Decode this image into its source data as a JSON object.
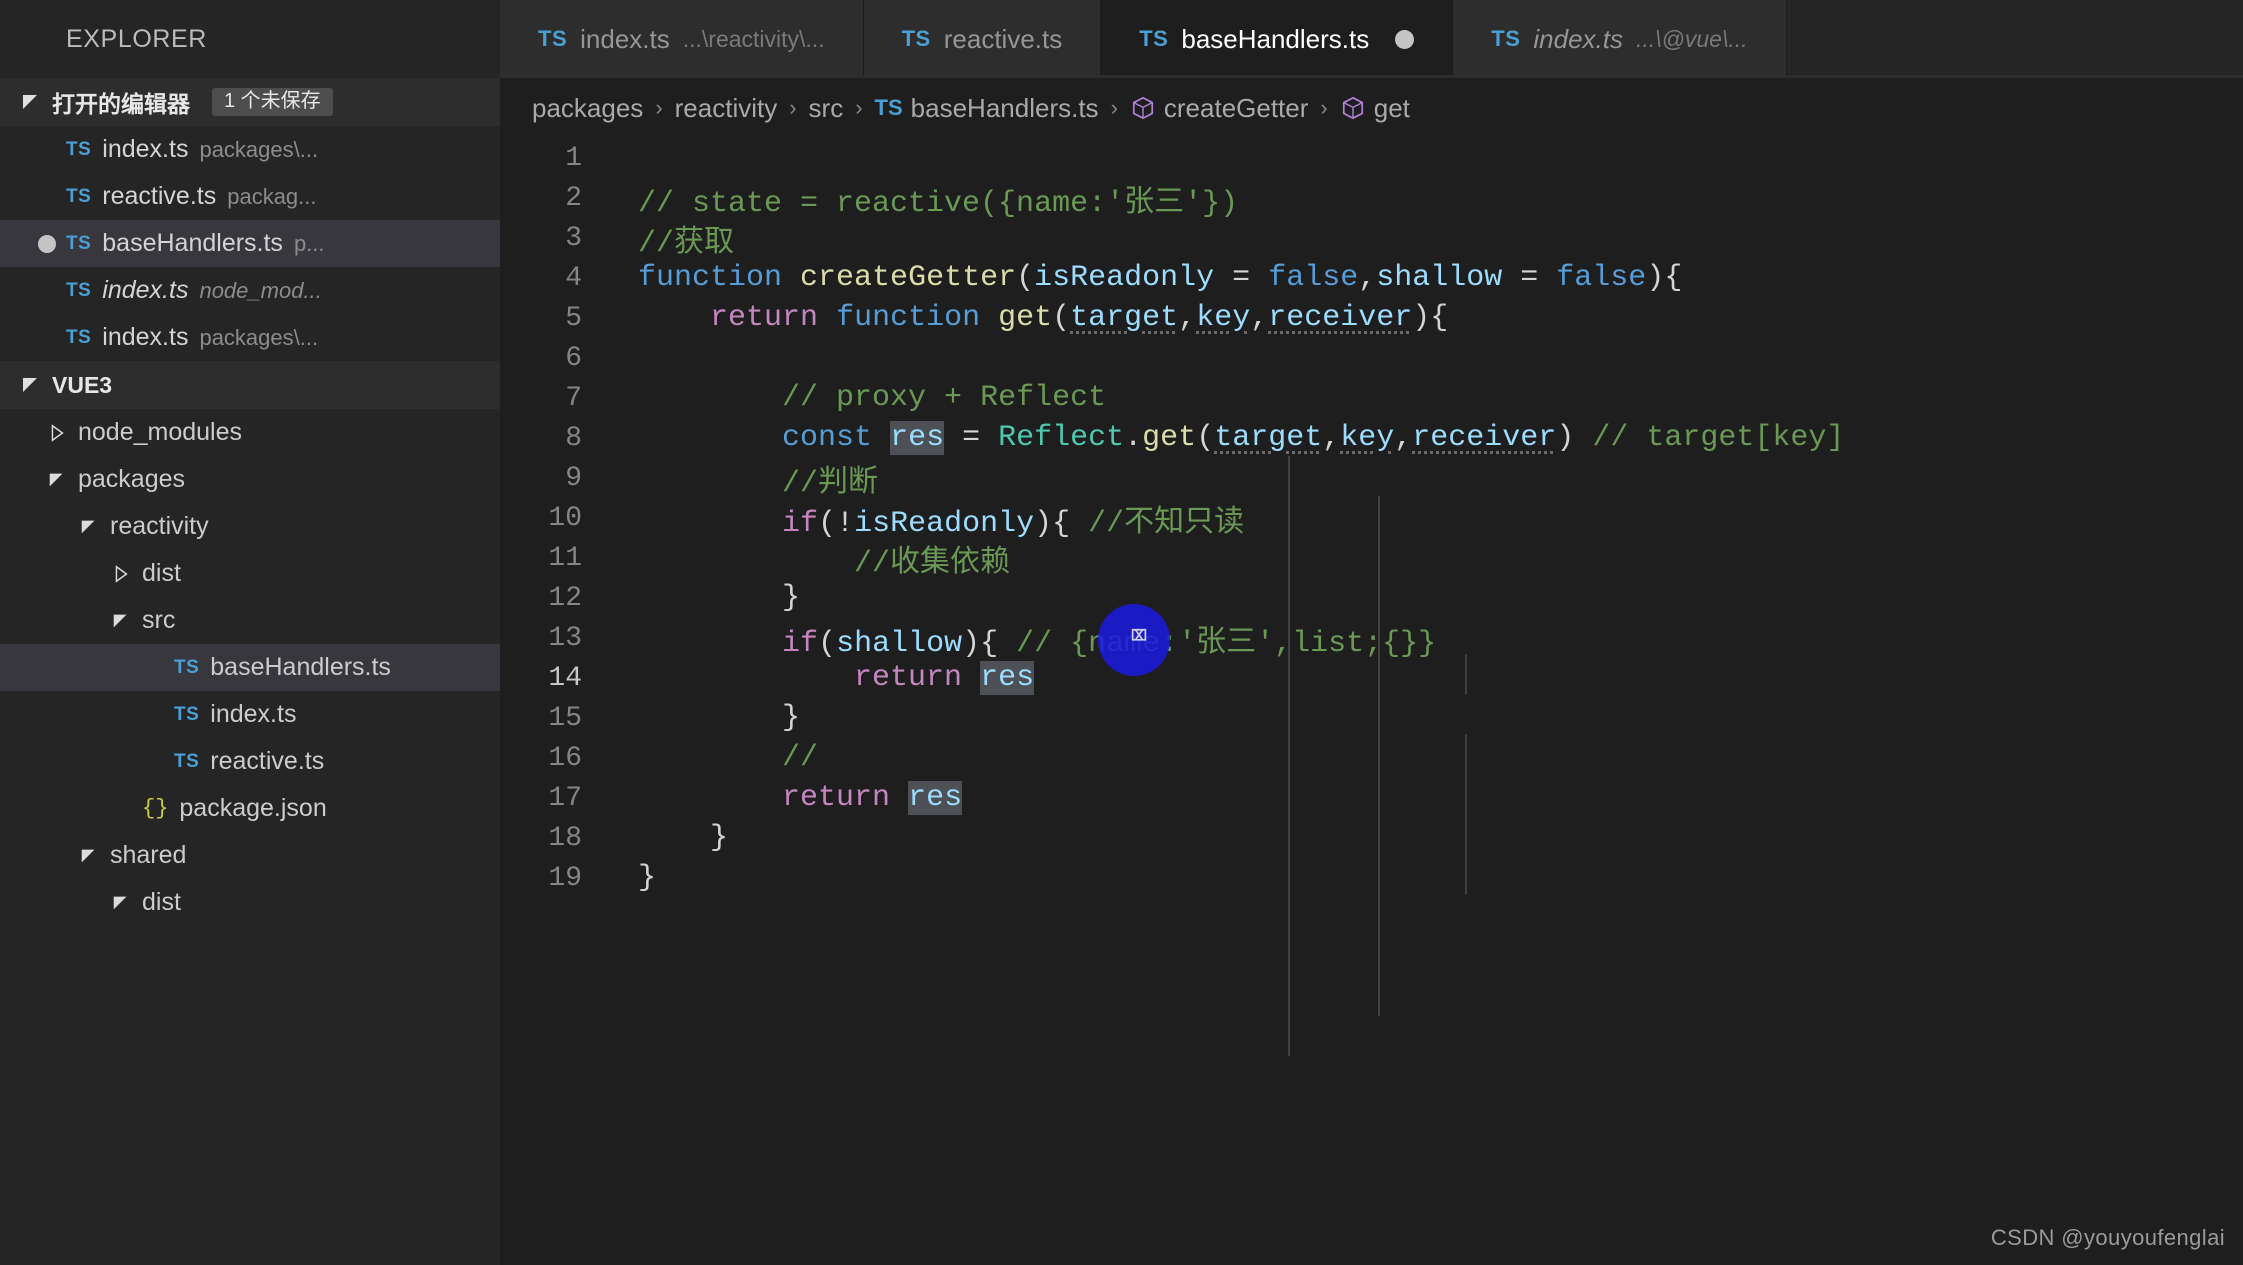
{
  "sidebar": {
    "title": "EXPLORER",
    "open_editors": {
      "label": "打开的编辑器",
      "badge": "1 个未保存",
      "items": [
        {
          "icon": "ts-file-icon",
          "name": "index.ts",
          "desc": "packages\\...",
          "dirty": false,
          "selected": false,
          "italic": false
        },
        {
          "icon": "ts-file-icon",
          "name": "reactive.ts",
          "desc": "packag...",
          "dirty": false,
          "selected": false,
          "italic": false
        },
        {
          "icon": "ts-file-icon",
          "name": "baseHandlers.ts",
          "desc": "p...",
          "dirty": true,
          "selected": true,
          "italic": false
        },
        {
          "icon": "ts-file-icon",
          "name": "index.ts",
          "desc": "node_mod...",
          "dirty": false,
          "selected": false,
          "italic": true
        },
        {
          "icon": "ts-file-icon",
          "name": "index.ts",
          "desc": "packages\\...",
          "dirty": false,
          "selected": false,
          "italic": false
        }
      ]
    },
    "workspace": {
      "label": "VUE3",
      "tree": [
        {
          "label": "node_modules",
          "depth": 1,
          "kind": "folder",
          "expanded": false,
          "selected": false
        },
        {
          "label": "packages",
          "depth": 1,
          "kind": "folder",
          "expanded": true,
          "selected": false
        },
        {
          "label": "reactivity",
          "depth": 2,
          "kind": "folder",
          "expanded": true,
          "selected": false
        },
        {
          "label": "dist",
          "depth": 3,
          "kind": "folder",
          "expanded": false,
          "selected": false
        },
        {
          "label": "src",
          "depth": 3,
          "kind": "folder",
          "expanded": true,
          "selected": false
        },
        {
          "label": "baseHandlers.ts",
          "depth": 4,
          "kind": "ts",
          "selected": true
        },
        {
          "label": "index.ts",
          "depth": 4,
          "kind": "ts",
          "selected": false
        },
        {
          "label": "reactive.ts",
          "depth": 4,
          "kind": "ts",
          "selected": false
        },
        {
          "label": "package.json",
          "depth": 3,
          "kind": "json",
          "selected": false
        },
        {
          "label": "shared",
          "depth": 2,
          "kind": "folder",
          "expanded": true,
          "selected": false
        },
        {
          "label": "dist",
          "depth": 3,
          "kind": "folder",
          "expanded": true,
          "selected": false
        }
      ]
    }
  },
  "tabs": [
    {
      "icon": "ts-file-icon",
      "name": "index.ts",
      "desc": "...\\reactivity\\...",
      "active": false,
      "dirty": false,
      "italic": false
    },
    {
      "icon": "ts-file-icon",
      "name": "reactive.ts",
      "desc": "",
      "active": false,
      "dirty": false,
      "italic": false
    },
    {
      "icon": "ts-file-icon",
      "name": "baseHandlers.ts",
      "desc": "",
      "active": true,
      "dirty": true,
      "italic": false
    },
    {
      "icon": "ts-file-icon",
      "name": "index.ts",
      "desc": "...\\@vue\\...",
      "active": false,
      "dirty": false,
      "italic": true
    }
  ],
  "breadcrumb": {
    "items": [
      {
        "label": "packages",
        "icon": ""
      },
      {
        "label": "reactivity",
        "icon": ""
      },
      {
        "label": "src",
        "icon": ""
      },
      {
        "label": "baseHandlers.ts",
        "icon": "ts-file-icon"
      },
      {
        "label": "createGetter",
        "icon": "symbol-function-icon"
      },
      {
        "label": "get",
        "icon": "symbol-function-icon"
      }
    ],
    "separator": "›"
  },
  "editor": {
    "language": "TypeScript",
    "current_line": 14,
    "lines": [
      {
        "n": "1",
        "text": ""
      },
      {
        "n": "2",
        "text": "// state = reactive({name:'张三'})"
      },
      {
        "n": "3",
        "text": "//获取"
      },
      {
        "n": "4",
        "text": "function createGetter(isReadonly = false,shallow = false){"
      },
      {
        "n": "5",
        "text": "    return function get(target,key,receiver){"
      },
      {
        "n": "6",
        "text": ""
      },
      {
        "n": "7",
        "text": "        // proxy + Reflect"
      },
      {
        "n": "8",
        "text": "        const res = Reflect.get(target,key,receiver) // target[key]"
      },
      {
        "n": "9",
        "text": "        //判断"
      },
      {
        "n": "10",
        "text": "        if(!isReadonly){ //不知只读"
      },
      {
        "n": "11",
        "text": "            //收集依赖"
      },
      {
        "n": "12",
        "text": "        }"
      },
      {
        "n": "13",
        "text": "        if(shallow){ // {name:'张三',list;{}}"
      },
      {
        "n": "14",
        "text": "            return res"
      },
      {
        "n": "15",
        "text": "        }"
      },
      {
        "n": "16",
        "text": "        //"
      },
      {
        "n": "17",
        "text": "        return res"
      },
      {
        "n": "18",
        "text": "    }"
      },
      {
        "n": "19",
        "text": "}"
      }
    ]
  },
  "watermark": "CSDN @youyoufenglai",
  "colors": {
    "editor_bg": "#1e1e1e",
    "sidebar_bg": "#252526",
    "tab_inactive_bg": "#2d2d2d",
    "selection_bg": "#264f78",
    "ts_icon": "#4a9fd4",
    "comment": "#6a9955",
    "keyword": "#569cd6",
    "control": "#c586c0",
    "function": "#dcdcaa",
    "variable": "#9cdcfe",
    "class": "#4ec9b0",
    "click_highlight": "#1b1bdd"
  }
}
